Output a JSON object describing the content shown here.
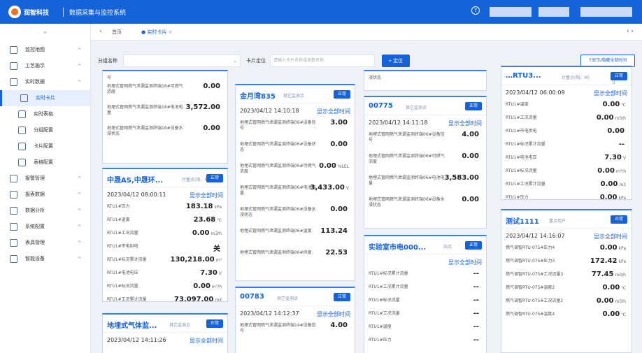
{
  "app": {
    "brand": "润智科技",
    "system": "数据采集与监控系统",
    "help_icon": "help-icon"
  },
  "sidebar": {
    "collapse": "»",
    "items": [
      {
        "label": "监控地图",
        "icon": "map-icon",
        "chev": "^"
      },
      {
        "label": "工艺画示",
        "icon": "flow-icon",
        "chev": "^"
      },
      {
        "label": "实时数据",
        "icon": "data-icon",
        "chev": "^"
      },
      {
        "label": "实时卡片",
        "icon": "card-icon"
      },
      {
        "label": "实时表格",
        "icon": "table-icon"
      },
      {
        "label": "分组配置",
        "icon": "group-icon"
      },
      {
        "label": "卡片配置",
        "icon": "config-icon"
      },
      {
        "label": "表格配置",
        "icon": "table-config-icon"
      },
      {
        "label": "报警管理",
        "icon": "alarm-icon",
        "chev": "^"
      },
      {
        "label": "报表数据",
        "icon": "report-icon",
        "chev": "^"
      },
      {
        "label": "数据分析",
        "icon": "analysis-icon",
        "chev": "^"
      },
      {
        "label": "系统配置",
        "icon": "system-icon",
        "chev": "^"
      },
      {
        "label": "表具管理",
        "icon": "meter-icon",
        "chev": "^"
      },
      {
        "label": "智能设备",
        "icon": "device-icon",
        "chev": "^"
      }
    ]
  },
  "tabs": {
    "prev": "‹",
    "next": "›",
    "home": "首页",
    "current": "实时卡片",
    "close": "×",
    "right_arrows": "› ›"
  },
  "filter": {
    "group_label": "分组名称",
    "group_value": "",
    "card_label": "卡片定位",
    "card_placeholder": "请输入卡片名称或表数名称",
    "locate_btn": "定位",
    "toggle_btn": "显示/隐藏全部时间"
  },
  "common": {
    "show_all": "显示全部时间",
    "status": "正常"
  },
  "cards": [
    {
      "title": "",
      "tag": "",
      "time": "",
      "rows": [
        {
          "label": "号",
          "value": "",
          "unit": ""
        },
        {
          "label": "地埋式管网燃气泄漏监测终端18#可燃气浓度",
          "value": "0.00",
          "unit": ""
        },
        {
          "label": "地埋式管网燃气泄漏监测终端18#电池电量",
          "value": "3,572.00",
          "unit": ""
        },
        {
          "label": "地埋式管网燃气泄漏监测终端18#设备水浸状态",
          "value": "0.00",
          "unit": ""
        }
      ]
    },
    {
      "title": "中晟AS,中晟环...",
      "tag": "计量点(阳、M)",
      "time": "2023/04/12 08:00:11",
      "rows": [
        {
          "label": "RTU1#压力",
          "value": "183.18",
          "unit": "kPa"
        },
        {
          "label": "RTU1#温度",
          "value": "23.68",
          "unit": "℃"
        },
        {
          "label": "RTU1#工况流量",
          "value": "0.00",
          "unit": "m3/h"
        },
        {
          "label": "RTU1#市电供电",
          "value": "关",
          "unit": ""
        },
        {
          "label": "RTU1#标况累计流量",
          "value": "130,218.00",
          "unit": "m³"
        },
        {
          "label": "RTU1#电池电压",
          "value": "7.30",
          "unit": "V"
        },
        {
          "label": "RTU1#标况流量",
          "value": "0.00",
          "unit": "m³/h"
        },
        {
          "label": "RTU1#工况累计流量",
          "value": "73,097.00",
          "unit": "m3"
        }
      ]
    },
    {
      "title": "地埋式气体监...",
      "tag": "其它监测点",
      "time": "2023/04/12 14:11:26",
      "rows": []
    },
    {
      "title": "金月湾835",
      "tag": "其它监测点",
      "time": "2023/04/12 14:10:18",
      "rows": [
        {
          "label": "地埋式管网燃气泄漏监测终端06#设备信号",
          "value": "3.00",
          "unit": ""
        },
        {
          "label": "地埋式管网燃气泄漏监测终端06#设备状态",
          "value": "0.00",
          "unit": ""
        },
        {
          "label": "地埋式管网燃气泄漏监测终端06#可燃气浓度",
          "value": "0.00",
          "unit": "%LEL"
        },
        {
          "label": "地埋式管网燃气泄漏监测终端06#电池电量",
          "value": "3,433.00",
          "unit": "V"
        },
        {
          "label": "地埋式管网燃气泄漏监测终端06#设备水浸状态",
          "value": "0.00",
          "unit": ""
        },
        {
          "label": "地埋式管网燃气泄漏监测终端06#温度",
          "value": "113.24",
          "unit": ""
        },
        {
          "label": "地埋式管网燃气泄漏监测终端06#纬度",
          "value": "22.53",
          "unit": ""
        }
      ]
    },
    {
      "title": "00783",
      "tag": "其它监测点",
      "time": "2023/04/12 14:12:37",
      "rows": [
        {
          "label": "地埋式管网燃气泄漏监测终端14#设备信号",
          "value": "4.00",
          "unit": ""
        }
      ]
    },
    {
      "title": "",
      "tag": "",
      "time": "",
      "rows": [
        {
          "label": "浸状态",
          "value": "",
          "unit": ""
        }
      ]
    },
    {
      "title": "00775",
      "tag": "其它监测点",
      "time": "2023/04/12 14:11:18",
      "rows": [
        {
          "label": "地埋式管网燃气泄漏监测终端06#设备信号",
          "value": "4.00",
          "unit": ""
        },
        {
          "label": "地埋式管网燃气泄漏监测终端06#可燃气浓度",
          "value": "0.00",
          "unit": ""
        },
        {
          "label": "地埋式管网燃气泄漏监测终端06#电池电量",
          "value": "3,583.00",
          "unit": ""
        },
        {
          "label": "地埋式管网燃气泄漏监测终端06#设备水浸状态",
          "value": "0.00",
          "unit": ""
        }
      ]
    },
    {
      "title": "实验室市电000...",
      "tag": "站点",
      "time": "",
      "rows": [
        {
          "label": "RTU1#标况累计流量",
          "value": "--",
          "unit": ""
        },
        {
          "label": "RTU1#工况累计流量",
          "value": "--",
          "unit": ""
        },
        {
          "label": "RTU1#标况流量",
          "value": "--",
          "unit": ""
        },
        {
          "label": "RTU1#工况流量",
          "value": "--",
          "unit": ""
        },
        {
          "label": "RTU1#温度",
          "value": "--",
          "unit": ""
        },
        {
          "label": "RTU1#压力",
          "value": "--",
          "unit": ""
        }
      ]
    },
    {
      "title": "…RTU3...",
      "tag": "计量点(阳、M)",
      "time": "2023/04/12 06:00:09",
      "rows": [
        {
          "label": "RTU1#温度",
          "value": "0.00",
          "unit": "℃"
        },
        {
          "label": "RTU1#工况流量",
          "value": "0.00",
          "unit": "m3/h"
        },
        {
          "label": "RTU1#市电供电",
          "value": "0.00",
          "unit": ""
        },
        {
          "label": "RTU1#标况累计流量",
          "value": "--",
          "unit": ""
        },
        {
          "label": "RTU1#电池电压",
          "value": "7.30",
          "unit": "V"
        },
        {
          "label": "RTU1#标况流量",
          "value": "0.00",
          "unit": "m³/h"
        },
        {
          "label": "RTU1#工况累计流量",
          "value": "0.00",
          "unit": "m3"
        },
        {
          "label": "RTU1#压力",
          "value": "0.00",
          "unit": "kPa"
        }
      ]
    },
    {
      "title": "测试1111",
      "tag": "重点用户",
      "time": "2023/04/12 14:16:07",
      "rows": [
        {
          "label": "燃气调智RTU-075#压力4",
          "value": "0.00",
          "unit": "kPa"
        },
        {
          "label": "燃气调智RTU-075#压力3",
          "value": "172.42",
          "unit": "kPa"
        },
        {
          "label": "燃气调智RTU-075#工况流量3",
          "value": "77.45",
          "unit": "m3/h"
        },
        {
          "label": "燃气调智RTU-075#温度2",
          "value": "0.00",
          "unit": "℃"
        },
        {
          "label": "燃气调智RTU-075#工况流量2",
          "value": "0.00",
          "unit": "m3/h"
        },
        {
          "label": "燃气调智RTU-075#温度4",
          "value": "0.00",
          "unit": "℃"
        }
      ]
    }
  ]
}
